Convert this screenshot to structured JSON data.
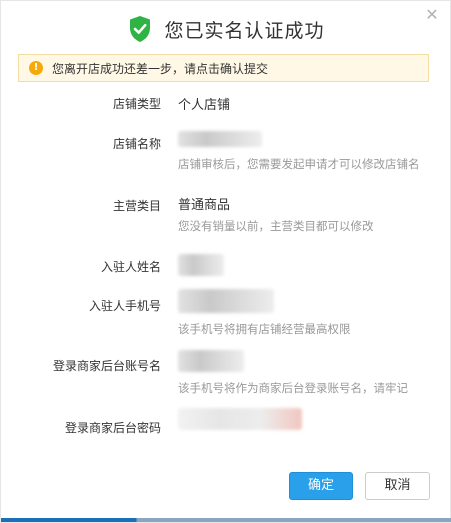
{
  "dialog": {
    "title": "您已实名认证成功",
    "close_icon": "close-icon",
    "shield_icon": "shield-check-icon"
  },
  "notice": {
    "icon": "warning-icon",
    "text": "您离开店成功还差一步，请点击确认提交"
  },
  "form": {
    "shop_type": {
      "label": "店铺类型",
      "value": "个人店铺"
    },
    "shop_name": {
      "label": "店铺名称",
      "hint": "店铺审核后，您需要发起申请才可以修改店铺名"
    },
    "category": {
      "label": "主营类目",
      "value": "普通商品",
      "hint": "您没有销量以前，主营类目都可以修改"
    },
    "settler_name": {
      "label": "入驻人姓名"
    },
    "settler_phone": {
      "label": "入驻人手机号",
      "hint": "该手机号将拥有店铺经营最高权限"
    },
    "backend_account": {
      "label": "登录商家后台账号名",
      "hint": "该手机号将作为商家后台登录账号名，请牢记"
    },
    "backend_password": {
      "label": "登录商家后台密码"
    }
  },
  "buttons": {
    "confirm": "确定",
    "cancel": "取消"
  },
  "colors": {
    "primary": "#2aa0ea",
    "success": "#2fb344",
    "warning": "#f7a90a",
    "notice_bg": "#fff8e6"
  }
}
